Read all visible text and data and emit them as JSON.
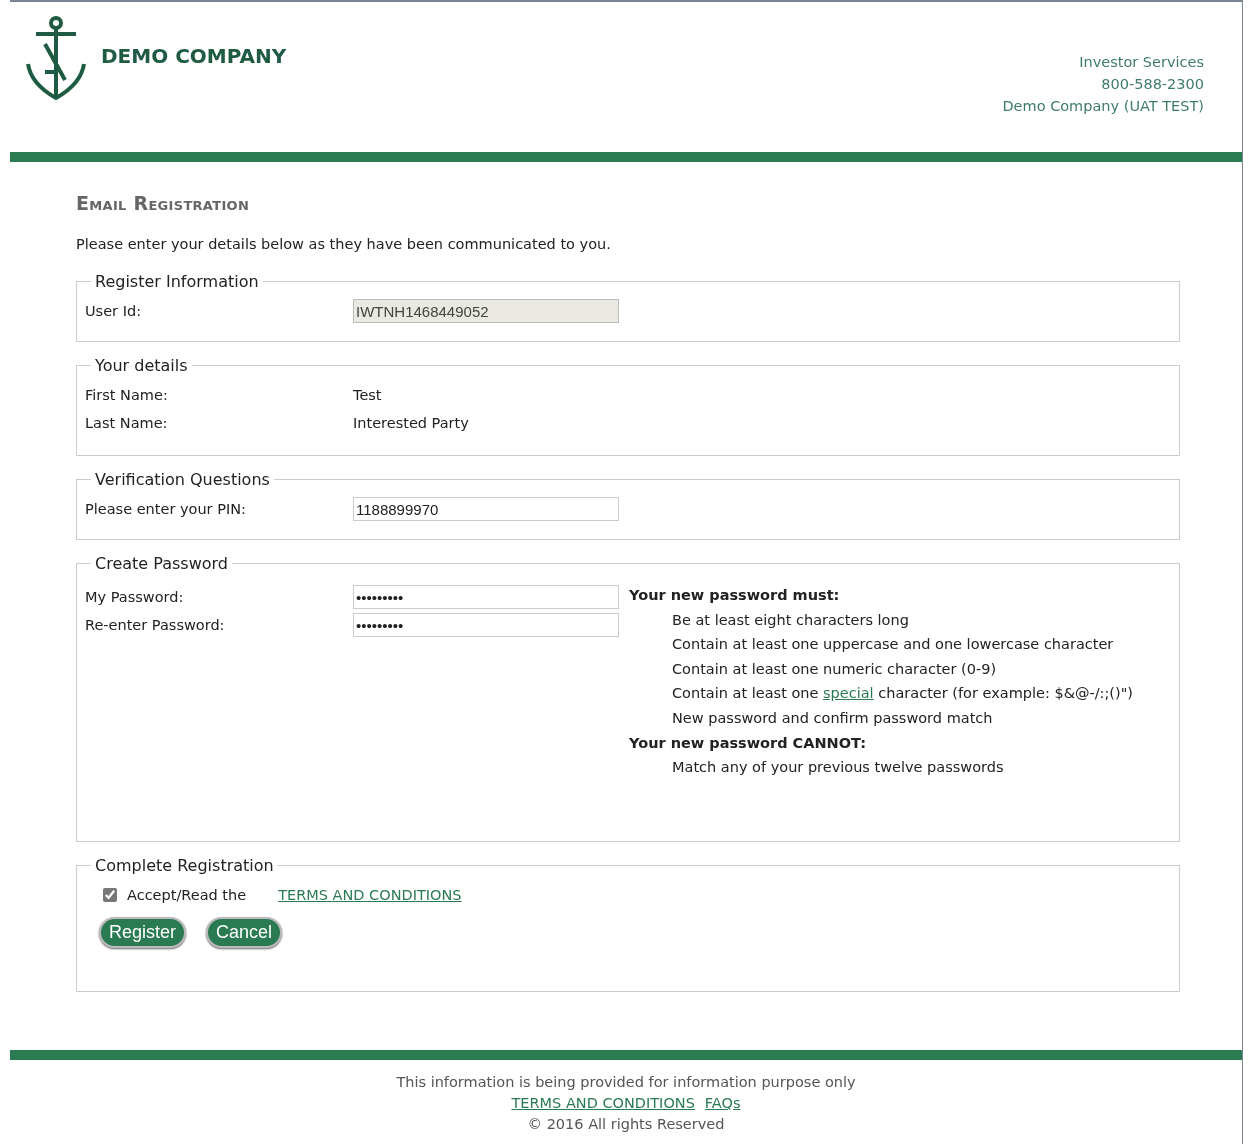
{
  "header": {
    "company_name": "DEMO COMPANY",
    "contact_lines": [
      "Investor Services",
      "800-588-2300",
      "Demo Company (UAT TEST)"
    ]
  },
  "title": "Email Registration",
  "intro": "Please enter your details below as they have been communicated to you.",
  "sections": [
    {
      "legend": "Register Information",
      "rows": [
        {
          "label": "User Id:",
          "kind": "input",
          "value": "IWTNH1468449052",
          "disabled": true
        }
      ]
    },
    {
      "legend": "Your details",
      "rows": [
        {
          "label": "First Name:",
          "kind": "text",
          "value": "Test"
        },
        {
          "label": "Last Name:",
          "kind": "text",
          "value": "Interested Party"
        }
      ]
    },
    {
      "legend": "Verification Questions",
      "rows": [
        {
          "label": "Please enter your PIN:",
          "kind": "input",
          "value": "1188899970",
          "disabled": false
        }
      ]
    },
    {
      "legend": "Create Password",
      "rows": [
        {
          "label": "My Password:",
          "kind": "password",
          "value": "•••••••••",
          "disabled": false
        },
        {
          "label": "Re-enter Password:",
          "kind": "password",
          "value": "•••••••••",
          "disabled": false
        }
      ],
      "rules": [
        {
          "kind": "heading",
          "text": "Your new password must:"
        },
        {
          "kind": "item",
          "text": "Be at least eight characters long"
        },
        {
          "kind": "item",
          "text": "Contain at least one uppercase and one lowercase character"
        },
        {
          "kind": "item",
          "text": "Contain at least one numeric character (0-9)"
        },
        {
          "kind": "linked",
          "before": "Contain at least one",
          "link": "special",
          "after": "character (for example: $&@-/:;()\")"
        },
        {
          "kind": "item",
          "text": "New password and confirm password match"
        },
        {
          "kind": "heading",
          "text": "Your new password CANNOT:"
        },
        {
          "kind": "item",
          "text": "Match any of your previous twelve passwords"
        }
      ]
    }
  ],
  "complete": {
    "legend": "Complete Registration",
    "checkbox": {
      "label": "Accept/Read the",
      "checked": true
    },
    "terms_link": "TERMS AND CONDITIONS",
    "buttons": [
      "Register",
      "Cancel"
    ]
  },
  "footer": {
    "notice": "This information is being provided for information purpose only",
    "links": [
      "TERMS AND CONDITIONS",
      "FAQs"
    ],
    "copyright": "© 2016 All rights Reserved"
  }
}
